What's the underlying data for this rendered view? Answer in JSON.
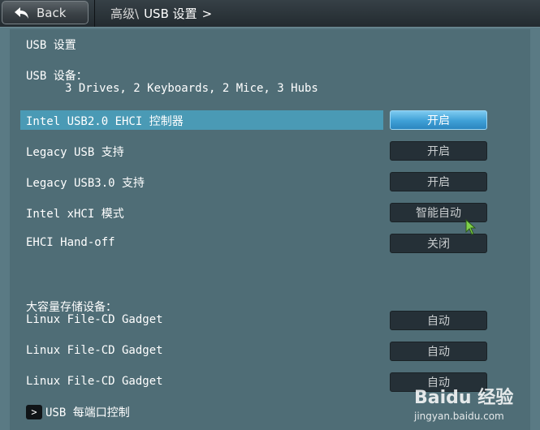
{
  "header": {
    "back_label": "Back",
    "breadcrumb_parent": "高级\\",
    "breadcrumb_current": "USB 设置",
    "breadcrumb_sep": ">"
  },
  "section": {
    "title": "USB 设置",
    "devices_label": "USB 设备：",
    "devices_value": "3 Drives, 2 Keyboards, 2 Mice, 3 Hubs"
  },
  "settings": [
    {
      "label": "Intel USB2.0 EHCI 控制器",
      "value": "开启",
      "selected": true
    },
    {
      "label": "Legacy USB 支持",
      "value": "开启",
      "selected": false
    },
    {
      "label": "Legacy USB3.0 支持",
      "value": "开启",
      "selected": false
    },
    {
      "label": "Intel xHCI 模式",
      "value": "智能自动",
      "selected": false
    },
    {
      "label": "EHCI Hand-off",
      "value": "关闭",
      "selected": false
    }
  ],
  "mass_storage": {
    "label": "大容量存储设备：",
    "devices": [
      {
        "label": "Linux File-CD Gadget",
        "value": "自动"
      },
      {
        "label": "Linux File-CD Gadget",
        "value": "自动"
      },
      {
        "label": "Linux File-CD Gadget",
        "value": "自动"
      }
    ]
  },
  "submenu": {
    "arrow": ">",
    "label": "USB 每端口控制"
  },
  "watermark": {
    "logo": "Baidu 经验",
    "url": "jingyan.baidu.com"
  },
  "icons": {
    "back": "back-arrow-icon",
    "cursor": "mouse-cursor-icon"
  },
  "colors": {
    "background": "#5a7a84",
    "highlight": "#4a9ab5",
    "active_button": "#3e9fd6",
    "button": "#253037"
  }
}
